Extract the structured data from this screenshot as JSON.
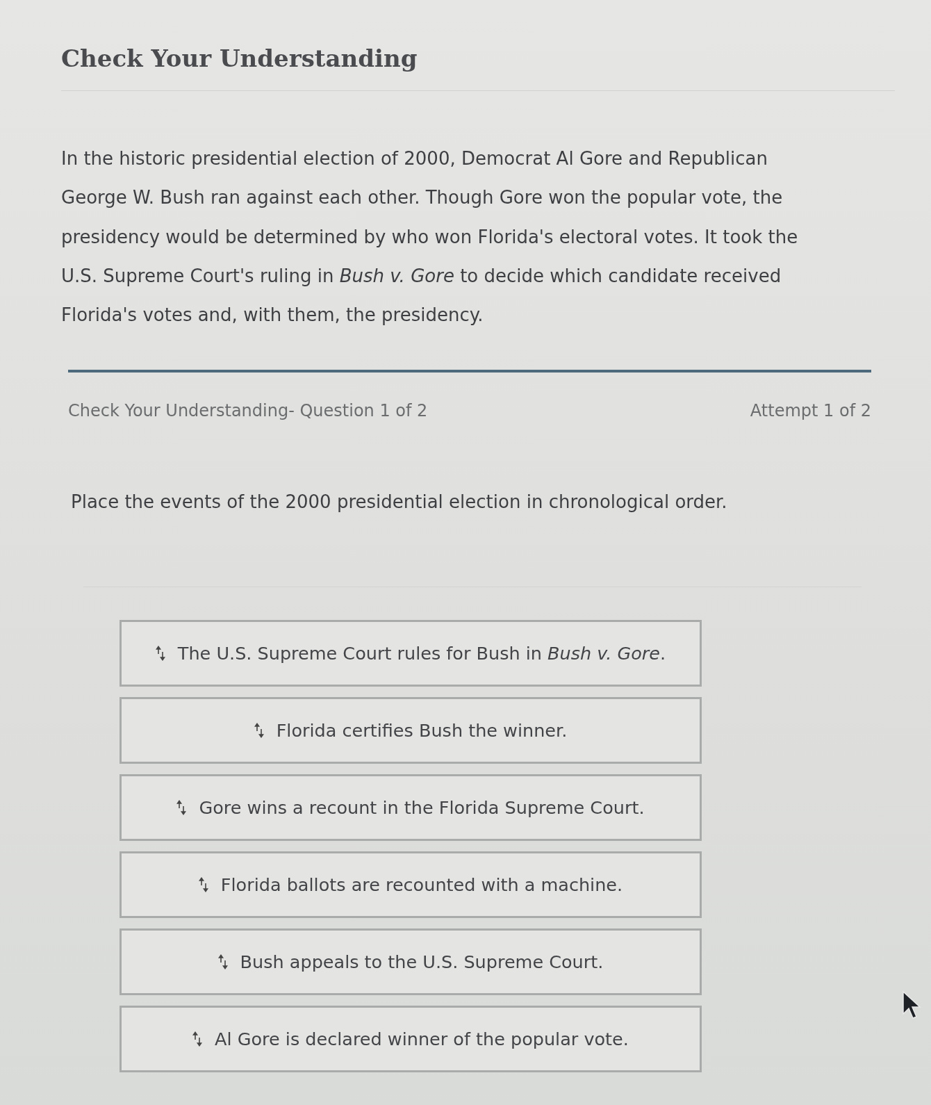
{
  "title": "Check Your Understanding",
  "passage": "In the historic presidential election of 2000, Democrat Al Gore and Republican George W. Bush ran against each other. Though Gore won the popular vote, the presidency would be determined by who won Florida's electoral votes. It took the U.S. Supreme Court's ruling in *Bush v. Gore* to decide which candidate received Florida's votes and, with them, the presidency.",
  "question_header": {
    "title": "Check Your Understanding- Question 1 of 2",
    "attempt": "Attempt 1 of 2"
  },
  "question": "Place the events of the 2000 presidential election in chronological order.",
  "items": [
    {
      "text": "The U.S. Supreme Court rules for Bush in *Bush v. Gore*."
    },
    {
      "text": "Florida certifies Bush the winner."
    },
    {
      "text": "Gore wins a recount in the Florida Supreme Court."
    },
    {
      "text": "Florida ballots are recounted with a machine."
    },
    {
      "text": "Bush appeals to the U.S. Supreme Court."
    },
    {
      "text": "Al Gore is declared winner of the popular vote."
    }
  ]
}
